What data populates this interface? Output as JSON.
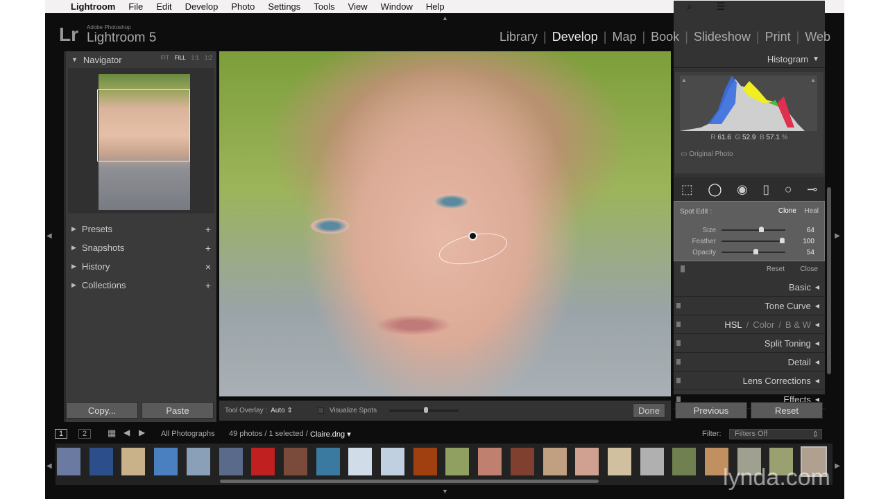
{
  "menubar": {
    "app": "Lightroom",
    "items": [
      "File",
      "Edit",
      "Develop",
      "Photo",
      "Settings",
      "Tools",
      "View",
      "Window",
      "Help"
    ]
  },
  "logo": {
    "mark": "Lr",
    "small": "Adobe Photoshop",
    "big": "Lightroom 5"
  },
  "modules": [
    "Library",
    "Develop",
    "Map",
    "Book",
    "Slideshow",
    "Print",
    "Web"
  ],
  "active_module": "Develop",
  "left": {
    "navigator": "Navigator",
    "zoom_opts": [
      "FIT",
      "FILL",
      "1:1",
      "1:2"
    ],
    "zoom_selected": "FILL",
    "sections": [
      {
        "label": "Presets",
        "act": "+"
      },
      {
        "label": "Snapshots",
        "act": "+"
      },
      {
        "label": "History",
        "act": "×"
      },
      {
        "label": "Collections",
        "act": "+"
      }
    ],
    "copy": "Copy...",
    "paste": "Paste"
  },
  "toolbar": {
    "overlay_label": "Tool Overlay :",
    "overlay_value": "Auto",
    "visualize": "Visualize Spots",
    "visualize_level": 0.5,
    "done": "Done"
  },
  "right": {
    "histogram": "Histogram",
    "r_label": "R",
    "r": "61.6",
    "g_label": "G",
    "g": "52.9",
    "b_label": "B",
    "b": "57.1",
    "pct": "%",
    "original": "Original Photo",
    "spot_edit": "Spot Edit :",
    "clone": "Clone",
    "heal": "Heal",
    "sliders": [
      {
        "label": "Size",
        "value": "64",
        "pos": 0.62
      },
      {
        "label": "Feather",
        "value": "100",
        "pos": 0.95
      },
      {
        "label": "Opacity",
        "value": "54",
        "pos": 0.53
      }
    ],
    "reset": "Reset",
    "close": "Close",
    "panels": [
      "Basic",
      "Tone Curve",
      "Split Toning",
      "Detail",
      "Lens Corrections",
      "Effects"
    ],
    "hsl": [
      "HSL",
      "/",
      "Color",
      "/",
      "B & W"
    ],
    "previous": "Previous",
    "reset_btn": "Reset"
  },
  "filmbar": {
    "page1": "1",
    "page2": "2",
    "source": "All Photographs",
    "count": "49 photos / 1 selected /",
    "file": "Claire.dng",
    "filter_label": "Filter:",
    "filter_value": "Filters Off"
  },
  "thumbs": [
    "#6a7aa0",
    "#2c4f8c",
    "#c9b18a",
    "#4a7fc0",
    "#8aa0b8",
    "#5a6a8a",
    "#c02020",
    "#7a4a3a",
    "#3a7aa0",
    "#d0dce8",
    "#c0d0e0",
    "#a04010",
    "#90a060",
    "#c08070",
    "#804030",
    "#c0a080",
    "#d0a090",
    "#d0c0a0",
    "#b0b0b0",
    "#708050",
    "#c09060",
    "#a0a090",
    "#9aa070",
    "#b0a090"
  ],
  "watermark": "lynda.com"
}
